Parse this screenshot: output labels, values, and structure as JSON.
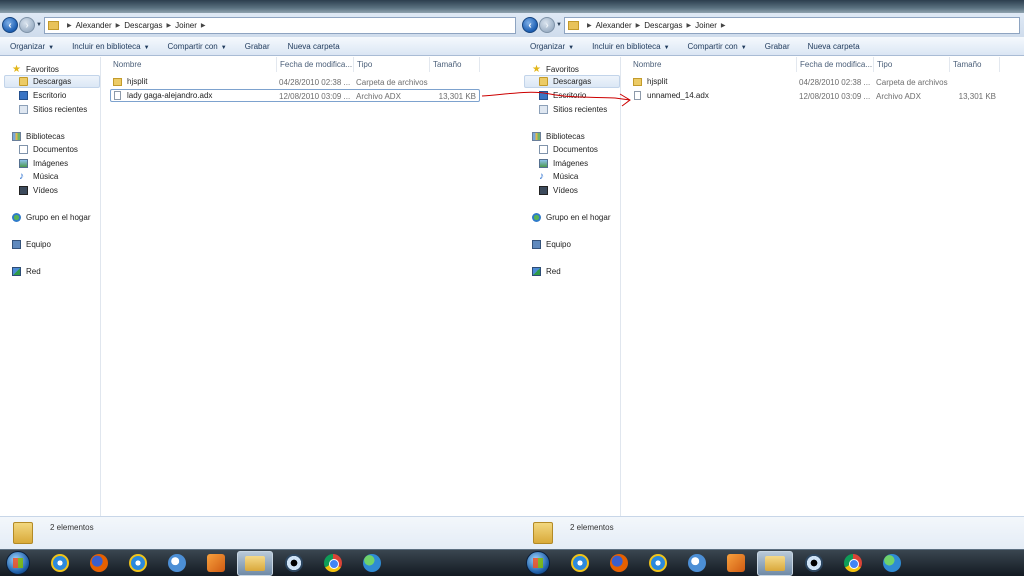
{
  "windows": [
    {
      "breadcrumb": [
        "Alexander",
        "Descargas",
        "Joiner"
      ],
      "toolbar": {
        "organize": "Organizar",
        "include": "Incluir en biblioteca",
        "share": "Compartir con",
        "burn": "Grabar",
        "new_folder": "Nueva carpeta"
      },
      "nav": {
        "favorites": "Favoritos",
        "downloads": "Descargas",
        "desktop": "Escritorio",
        "recent": "Sitios recientes",
        "libraries": "Bibliotecas",
        "documents": "Documentos",
        "images": "Imágenes",
        "music": "Música",
        "videos": "Vídeos",
        "homegroup": "Grupo en el hogar",
        "computer": "Equipo",
        "network": "Red"
      },
      "columns": {
        "name": "Nombre",
        "date": "Fecha de modifica...",
        "type": "Tipo",
        "size": "Tamaño"
      },
      "files": [
        {
          "name": "hjsplit",
          "date": "04/28/2010 02:38 ...",
          "type": "Carpeta de archivos",
          "size": ""
        },
        {
          "name": "lady gaga-alejandro.adx",
          "date": "12/08/2010 03:09 ...",
          "type": "Archivo ADX",
          "size": "13,301 KB"
        }
      ],
      "status": "2 elementos"
    },
    {
      "breadcrumb": [
        "Alexander",
        "Descargas",
        "Joiner"
      ],
      "toolbar": {
        "organize": "Organizar",
        "include": "Incluir en biblioteca",
        "share": "Compartir con",
        "burn": "Grabar",
        "new_folder": "Nueva carpeta"
      },
      "nav": {
        "favorites": "Favoritos",
        "downloads": "Descargas",
        "desktop": "Escritorio",
        "recent": "Sitios recientes",
        "libraries": "Bibliotecas",
        "documents": "Documentos",
        "images": "Imágenes",
        "music": "Música",
        "videos": "Vídeos",
        "homegroup": "Grupo en el hogar",
        "computer": "Equipo",
        "network": "Red"
      },
      "columns": {
        "name": "Nombre",
        "date": "Fecha de modifica...",
        "type": "Tipo",
        "size": "Tamaño"
      },
      "files": [
        {
          "name": "hjsplit",
          "date": "04/28/2010 02:38 ...",
          "type": "Carpeta de archivos",
          "size": ""
        },
        {
          "name": "unnamed_14.adx",
          "date": "12/08/2010 03:09 ...",
          "type": "Archivo ADX",
          "size": "13,301 KB"
        }
      ],
      "status": "2 elementos"
    }
  ],
  "taskbar_apps": [
    "internet-explorer-icon",
    "firefox-icon",
    "internet-explorer-icon",
    "windows-live-messenger-icon",
    "media-player-icon",
    "windows-explorer-icon",
    "eye-viewer-icon",
    "chrome-icon",
    "msn-messenger-icon"
  ],
  "colors": {
    "annotation_line": "#cc0000",
    "selection": "#dbe7f5",
    "chrome_dark": "#2c3e4e"
  }
}
